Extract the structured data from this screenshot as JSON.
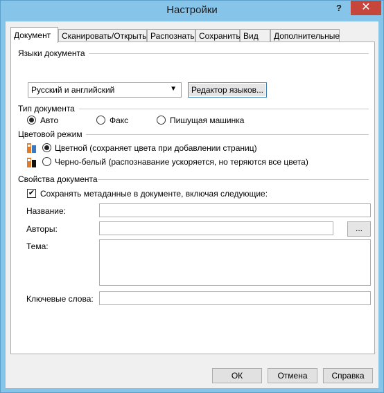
{
  "window": {
    "title": "Настройки",
    "help_glyph": "?",
    "close_glyph": "✕"
  },
  "tabs": [
    {
      "label": "Документ",
      "active": true
    },
    {
      "label": "Сканировать/Открыть",
      "active": false
    },
    {
      "label": "Распознать",
      "active": false
    },
    {
      "label": "Сохранить",
      "active": false
    },
    {
      "label": "Вид",
      "active": false
    },
    {
      "label": "Дополнительные",
      "active": false
    }
  ],
  "doc_languages": {
    "title": "Языки документа",
    "selected": "Русский и английский",
    "editor_button": "Редактор языков..."
  },
  "doc_type": {
    "title": "Тип документа",
    "options": [
      "Авто",
      "Факс",
      "Пишущая машинка"
    ],
    "selected_index": 0
  },
  "color_mode": {
    "title": "Цветовой режим",
    "options": [
      "Цветной (сохраняет цвета при добавлении страниц)",
      "Черно-белый (распознавание ускоряется, но теряются все цвета)"
    ],
    "selected_index": 0
  },
  "properties": {
    "title": "Свойства документа",
    "save_metadata_label": "Сохранять метаданные в документе, включая следующие:",
    "save_metadata_checked": true,
    "name_label": "Название:",
    "name_value": "",
    "authors_label": "Авторы:",
    "authors_value": "",
    "browse_button": "...",
    "subject_label": "Тема:",
    "subject_value": "",
    "keywords_label": "Ключевые слова:",
    "keywords_value": ""
  },
  "footer": {
    "ok": "ОК",
    "cancel": "Отмена",
    "help": "Справка"
  }
}
